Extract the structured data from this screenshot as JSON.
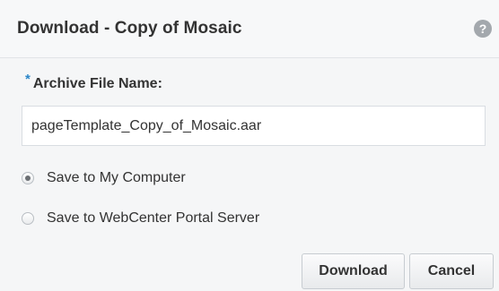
{
  "dialog": {
    "title": "Download - Copy of Mosaic",
    "help_icon": "?"
  },
  "form": {
    "required_marker": "*",
    "archive_label": "Archive File Name:",
    "archive_value": "pageTemplate_Copy_of_Mosaic.aar"
  },
  "options": [
    {
      "label": "Save to My Computer",
      "checked": true
    },
    {
      "label": "Save to WebCenter Portal Server",
      "checked": false
    }
  ],
  "buttons": {
    "download": "Download",
    "cancel": "Cancel"
  },
  "icons": {
    "help": "help-icon"
  },
  "colors": {
    "accent": "#2a86c8",
    "background": "#f5f6f7",
    "header_background": "#f7f8f9"
  }
}
